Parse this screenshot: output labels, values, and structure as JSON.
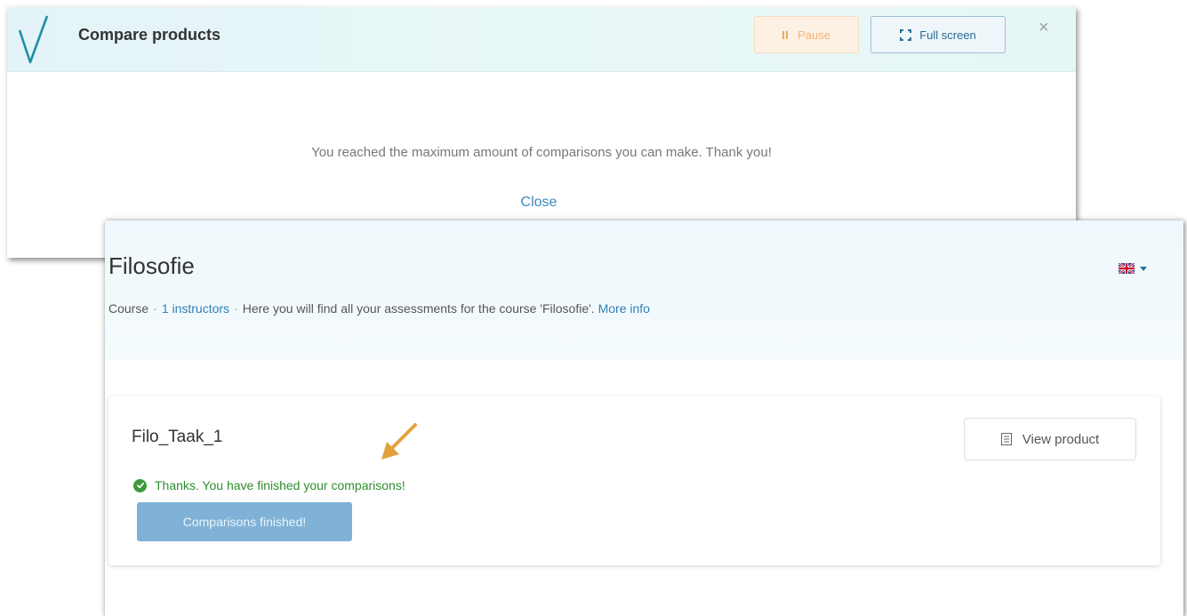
{
  "modal": {
    "title": "Compare products",
    "pause_label": "Pause",
    "fullscreen_label": "Full screen",
    "close_icon": "×",
    "message": "You reached the maximum amount of comparisons you can make. Thank you!",
    "close_link": "Close"
  },
  "course": {
    "title": "Filosofie",
    "meta": {
      "type": "Course",
      "separator": "·",
      "instructors_link": "1 instructors",
      "description": "Here you will find all your assessments for the course 'Filosofie'.",
      "more_info_link": "More info"
    },
    "language_flag": "uk-flag-icon",
    "assessment": {
      "title": "Filo_Taak_1",
      "view_button": "View product",
      "status_text": "Thanks. You have finished your comparisons!",
      "finished_button": "Comparisons finished!"
    }
  },
  "colors": {
    "accent_teal": "#1f8fa6",
    "link_blue": "#2f7fb5",
    "success_green": "#2e8d2e",
    "finished_button_bg": "#7fb2d6",
    "pause_orange": "#f0b478",
    "annotation_arrow": "#e3a13c"
  }
}
